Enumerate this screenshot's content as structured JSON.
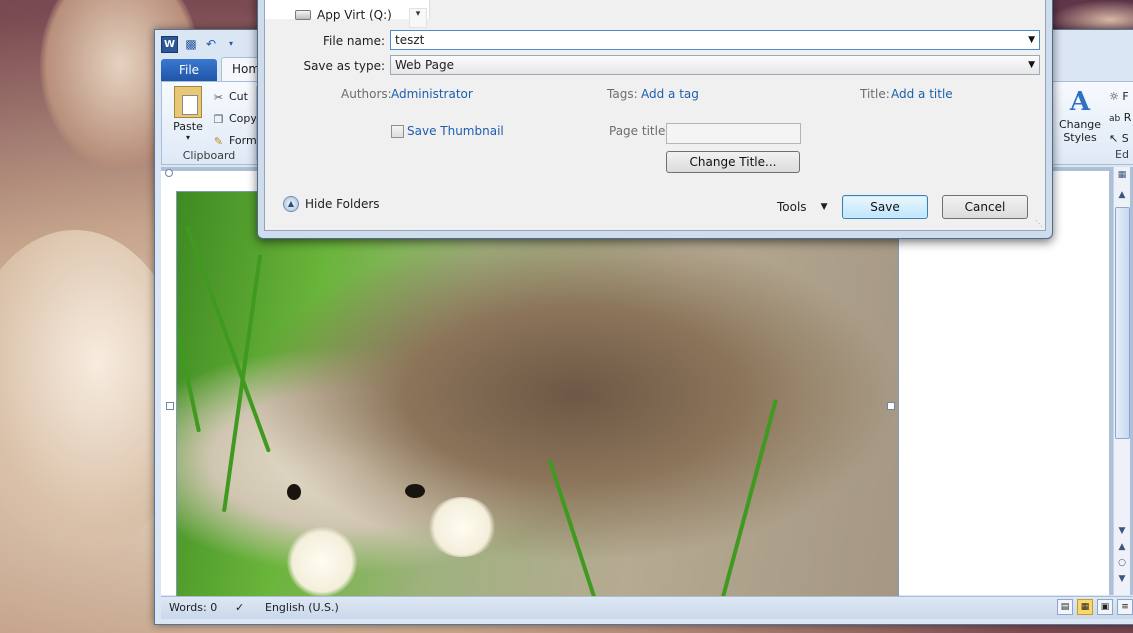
{
  "word": {
    "logo": "W",
    "tabs": {
      "file": "File",
      "home": "Hom"
    },
    "ribbon": {
      "paste_label": "Paste",
      "cut_label": "Cut",
      "copy_label": "Copy",
      "format_label": "Form",
      "clipboard_group": "Clipboard",
      "change_styles_line1": "Change",
      "change_styles_line2": "Styles",
      "find_label": "F",
      "replace_label": "R",
      "select_label": "S",
      "editing_group": "Ed"
    },
    "status": {
      "words": "Words: 0",
      "language": "English (U.S.)"
    }
  },
  "dialog": {
    "folder_item": "App Virt (Q:)",
    "file_name_label": "File name:",
    "file_name_value": "teszt",
    "save_type_label": "Save as type:",
    "save_type_value": "Web Page",
    "authors_label": "Authors:",
    "authors_value": "Administrator",
    "tags_label": "Tags:",
    "tags_value": "Add a tag",
    "title_label": "Title:",
    "title_value": "Add a title",
    "save_thumbnail": "Save Thumbnail",
    "page_title_label": "Page title:",
    "page_title_value": "",
    "change_title": "Change Title...",
    "hide_folders": "Hide Folders",
    "tools": "Tools",
    "save": "Save",
    "cancel": "Cancel"
  },
  "colors": {
    "file_tab": "#2b63b8",
    "link": "#1c5fae",
    "dialog_frame": "#cfdcec"
  }
}
